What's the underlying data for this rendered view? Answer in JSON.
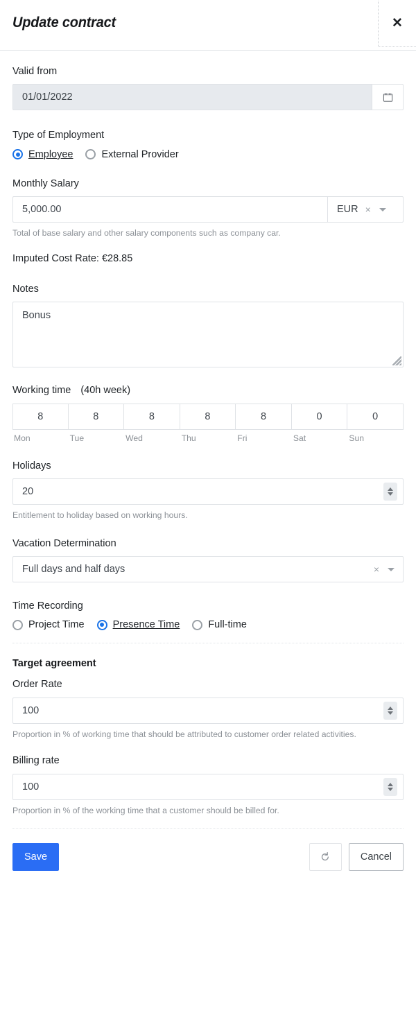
{
  "header": {
    "title": "Update contract",
    "close_label": "✕"
  },
  "valid_from": {
    "label": "Valid from",
    "value": "01/01/2022",
    "calendar_icon": "calendar-icon"
  },
  "employment_type": {
    "label": "Type of Employment",
    "options": [
      {
        "label": "Employee",
        "selected": true
      },
      {
        "label": "External Provider",
        "selected": false
      }
    ]
  },
  "monthly_salary": {
    "label": "Monthly Salary",
    "value": "5,000.00",
    "currency": "EUR",
    "clear_icon": "×",
    "hint": "Total of base salary and other salary components such as company car."
  },
  "imputed_cost_rate": {
    "text": "Imputed Cost Rate: €28.85"
  },
  "notes": {
    "label": "Notes",
    "value": "Bonus"
  },
  "working_time": {
    "label": "Working time",
    "summary": "(40h week)",
    "days": [
      {
        "day": "Mon",
        "hours": "8"
      },
      {
        "day": "Tue",
        "hours": "8"
      },
      {
        "day": "Wed",
        "hours": "8"
      },
      {
        "day": "Thu",
        "hours": "8"
      },
      {
        "day": "Fri",
        "hours": "8"
      },
      {
        "day": "Sat",
        "hours": "0"
      },
      {
        "day": "Sun",
        "hours": "0"
      }
    ]
  },
  "holidays": {
    "label": "Holidays",
    "value": "20",
    "hint": "Entitlement to holiday based on working hours."
  },
  "vacation_determination": {
    "label": "Vacation Determination",
    "value": "Full days and half days",
    "clear_icon": "×"
  },
  "time_recording": {
    "label": "Time Recording",
    "options": [
      {
        "label": "Project Time",
        "selected": false
      },
      {
        "label": "Presence Time",
        "selected": true
      },
      {
        "label": "Full-time",
        "selected": false
      }
    ]
  },
  "target_agreement": {
    "heading": "Target agreement",
    "order_rate": {
      "label": "Order Rate",
      "value": "100",
      "hint": "Proportion in % of working time that should be attributed to customer order related activities."
    },
    "billing_rate": {
      "label": "Billing rate",
      "value": "100",
      "hint": "Proportion in % of the working time that a customer should be billed for."
    }
  },
  "footer": {
    "save_label": "Save",
    "reset_icon": "reset-icon",
    "cancel_label": "Cancel"
  },
  "colors": {
    "accent": "#2a6df4",
    "radio_selected": "#1a73e8",
    "disabled_bg": "#e7eaee",
    "border": "#dfe2e6",
    "hint_text": "#8c9197"
  }
}
